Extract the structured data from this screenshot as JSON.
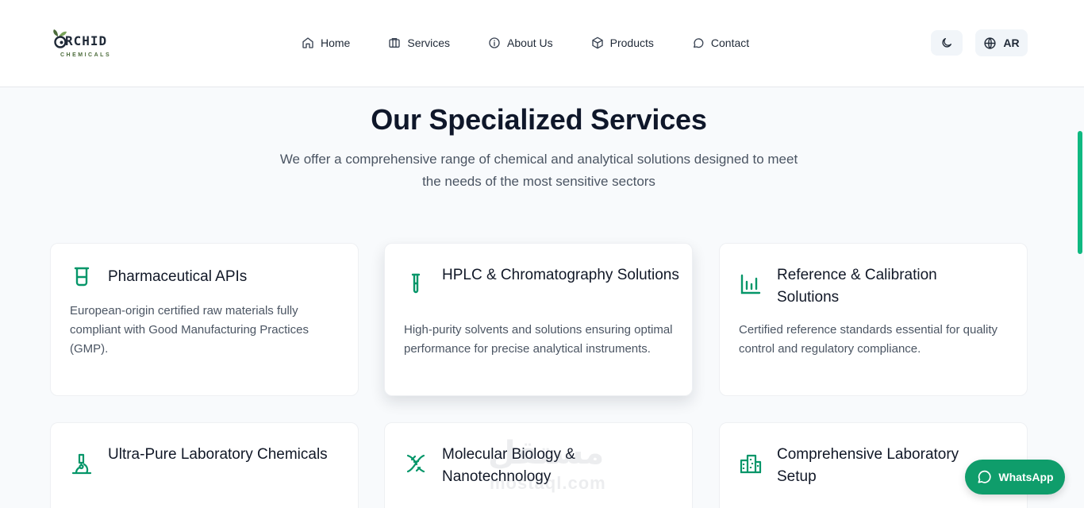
{
  "header": {
    "logo": {
      "word": "RCHID",
      "sub": "CHEMICALS"
    },
    "nav": [
      {
        "label": "Home",
        "icon": "home-icon"
      },
      {
        "label": "Services",
        "icon": "services-icon"
      },
      {
        "label": "About Us",
        "icon": "info-icon"
      },
      {
        "label": "Products",
        "icon": "box-icon"
      },
      {
        "label": "Contact",
        "icon": "message-icon"
      }
    ],
    "theme_toggle_icon": "moon-icon",
    "language": {
      "label": "AR",
      "icon": "globe-icon"
    }
  },
  "main": {
    "title": "Our Specialized Services",
    "subtitle": "We offer a comprehensive range of chemical and analytical solutions designed to meet the needs of the most sensitive sectors",
    "cards": [
      {
        "title": "Pharmaceutical APIs",
        "description": "European-origin certified raw materials fully compliant with Good Manufacturing Practices (GMP).",
        "icon": "beaker-icon"
      },
      {
        "title": "HPLC & Chromatography Solutions",
        "description": "High-purity solvents and solutions ensuring optimal performance for precise analytical instruments.",
        "icon": "test-tube-icon"
      },
      {
        "title": "Reference & Calibration Solutions",
        "description": "Certified reference standards essential for quality control and regulatory compliance.",
        "icon": "bar-chart-icon"
      },
      {
        "title": "Ultra-Pure Laboratory Chemicals",
        "description": "",
        "icon": "microscope-icon"
      },
      {
        "title": "Molecular Biology & Nanotechnology",
        "description": "",
        "icon": "dna-icon"
      },
      {
        "title": "Comprehensive Laboratory Setup",
        "description": "",
        "icon": "building-icon"
      }
    ]
  },
  "whatsapp": {
    "label": "WhatsApp",
    "icon": "whatsapp-icon"
  },
  "watermark": {
    "arabic": "مستقل",
    "latin": "mostaql.com"
  },
  "colors": {
    "accent": "#10b981",
    "whatsapp": "#0f9d6b",
    "icon": "#059669",
    "title": "#0f172a"
  }
}
